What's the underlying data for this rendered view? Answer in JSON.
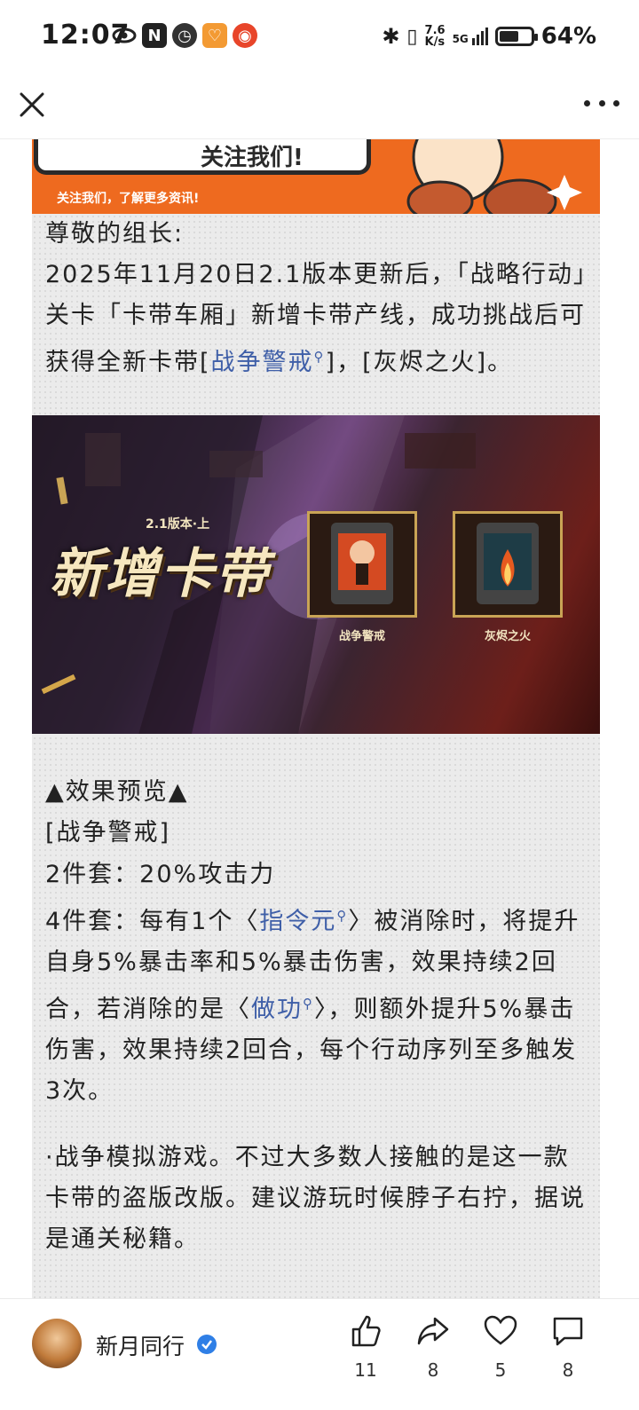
{
  "status_bar": {
    "time": "12:07",
    "net_speed_top": "7.6",
    "net_speed_bottom": "K/s",
    "signal": "5G",
    "battery": "64%",
    "battery_level": 0.64
  },
  "header": {
    "close_icon": "close-icon",
    "more_icon": "more-icon"
  },
  "banner": {
    "title": "关注我们!",
    "subtitle": "关注我们，了解更多资讯!"
  },
  "intro": {
    "greeting": "尊敬的组长:",
    "line1": "2025年11月20日2.1版本更新后，「战略行动」关卡「卡带车厢」新增卡带产线，成功挑战后可获得全新卡带[",
    "link1": "战争警戒",
    "line1_end": "]，[灰烬之火]。"
  },
  "promo": {
    "version": "2.1版本·上",
    "title": "新增卡带",
    "card1": "战争警戒",
    "card2": "灰烬之火"
  },
  "effects": {
    "heading": "▲效果预览▲",
    "name": "[战争警戒]",
    "set2": "2件套：20%攻击力",
    "set4_a": "4件套：每有1个〈",
    "set4_link1": "指令元",
    "set4_b": "〉被消除时，将提升自身5%暴击率和5%暴击伤害，效果持续2回合，若消除的是〈",
    "set4_link2": "做功",
    "set4_c": "〉，则额外提升5%暴击伤害，效果持续2回合，每个行动序列至多触发3次。",
    "note": "·战争模拟游戏。不过大多数人接触的是这一款卡带的盗版改版。建议游玩时候脖子右拧，据说是通关秘籍。"
  },
  "footer": {
    "author": "新月同行",
    "likes": "11",
    "shares": "8",
    "favorites": "5",
    "comments": "8"
  }
}
